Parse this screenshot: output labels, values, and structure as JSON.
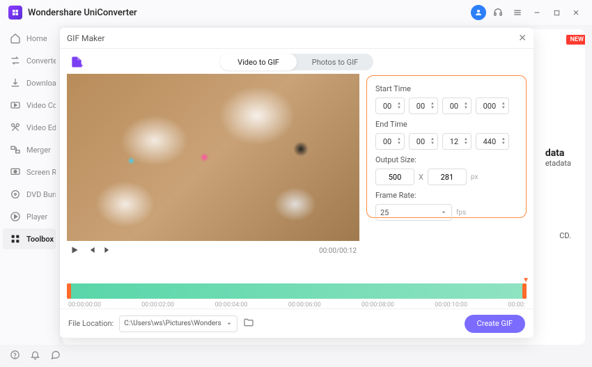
{
  "app": {
    "name": "Wondershare UniConverter"
  },
  "titlebar_icons": {
    "user": "user-icon",
    "headset": "headset-icon",
    "menu": "menu-icon",
    "min": "minimize-icon",
    "max": "maximize-icon",
    "close": "close-icon"
  },
  "sidebar": {
    "items": [
      {
        "label": "Home",
        "icon": "home",
        "key": "home"
      },
      {
        "label": "Converter",
        "icon": "convert",
        "key": "converter"
      },
      {
        "label": "Downloader",
        "icon": "download",
        "key": "downloader"
      },
      {
        "label": "Video Compressor",
        "icon": "compress",
        "key": "video-compressor"
      },
      {
        "label": "Video Editor",
        "icon": "scissors",
        "key": "video-editor"
      },
      {
        "label": "Merger",
        "icon": "merge",
        "key": "merger"
      },
      {
        "label": "Screen Recorder",
        "icon": "record",
        "key": "screen-recorder"
      },
      {
        "label": "DVD Burner",
        "icon": "disc",
        "key": "dvd-burner"
      },
      {
        "label": "Player",
        "icon": "play",
        "key": "player"
      },
      {
        "label": "Toolbox",
        "icon": "grid",
        "key": "toolbox"
      }
    ],
    "active": "toolbox"
  },
  "background": {
    "new_badge": "NEW",
    "meta_head": "data",
    "meta_sub": "etadata",
    "cd_text": "CD."
  },
  "modal": {
    "title": "GIF Maker",
    "tabs": {
      "video": "Video to GIF",
      "photos": "Photos to GIF",
      "active": "video"
    },
    "play_time": "00:00/00:12",
    "start_label": "Start Time",
    "end_label": "End Time",
    "start": {
      "h": "00",
      "m": "00",
      "s": "00",
      "ms": "000"
    },
    "end": {
      "h": "00",
      "m": "00",
      "s": "12",
      "ms": "440"
    },
    "output_label": "Output Size:",
    "output": {
      "w": "500",
      "h": "281",
      "unit": "px"
    },
    "framerate_label": "Frame Rate:",
    "framerate_value": "25",
    "framerate_unit": "fps",
    "ticks": [
      "00:00:00:00",
      "00:00:02:00",
      "00:00:04:00",
      "00:00:06:00",
      "00:00:08:00",
      "00:00:10:00",
      "00:00:"
    ],
    "file_location_label": "File Location:",
    "file_location_path": "C:\\Users\\ws\\Pictures\\Wonders",
    "create_label": "Create GIF"
  }
}
